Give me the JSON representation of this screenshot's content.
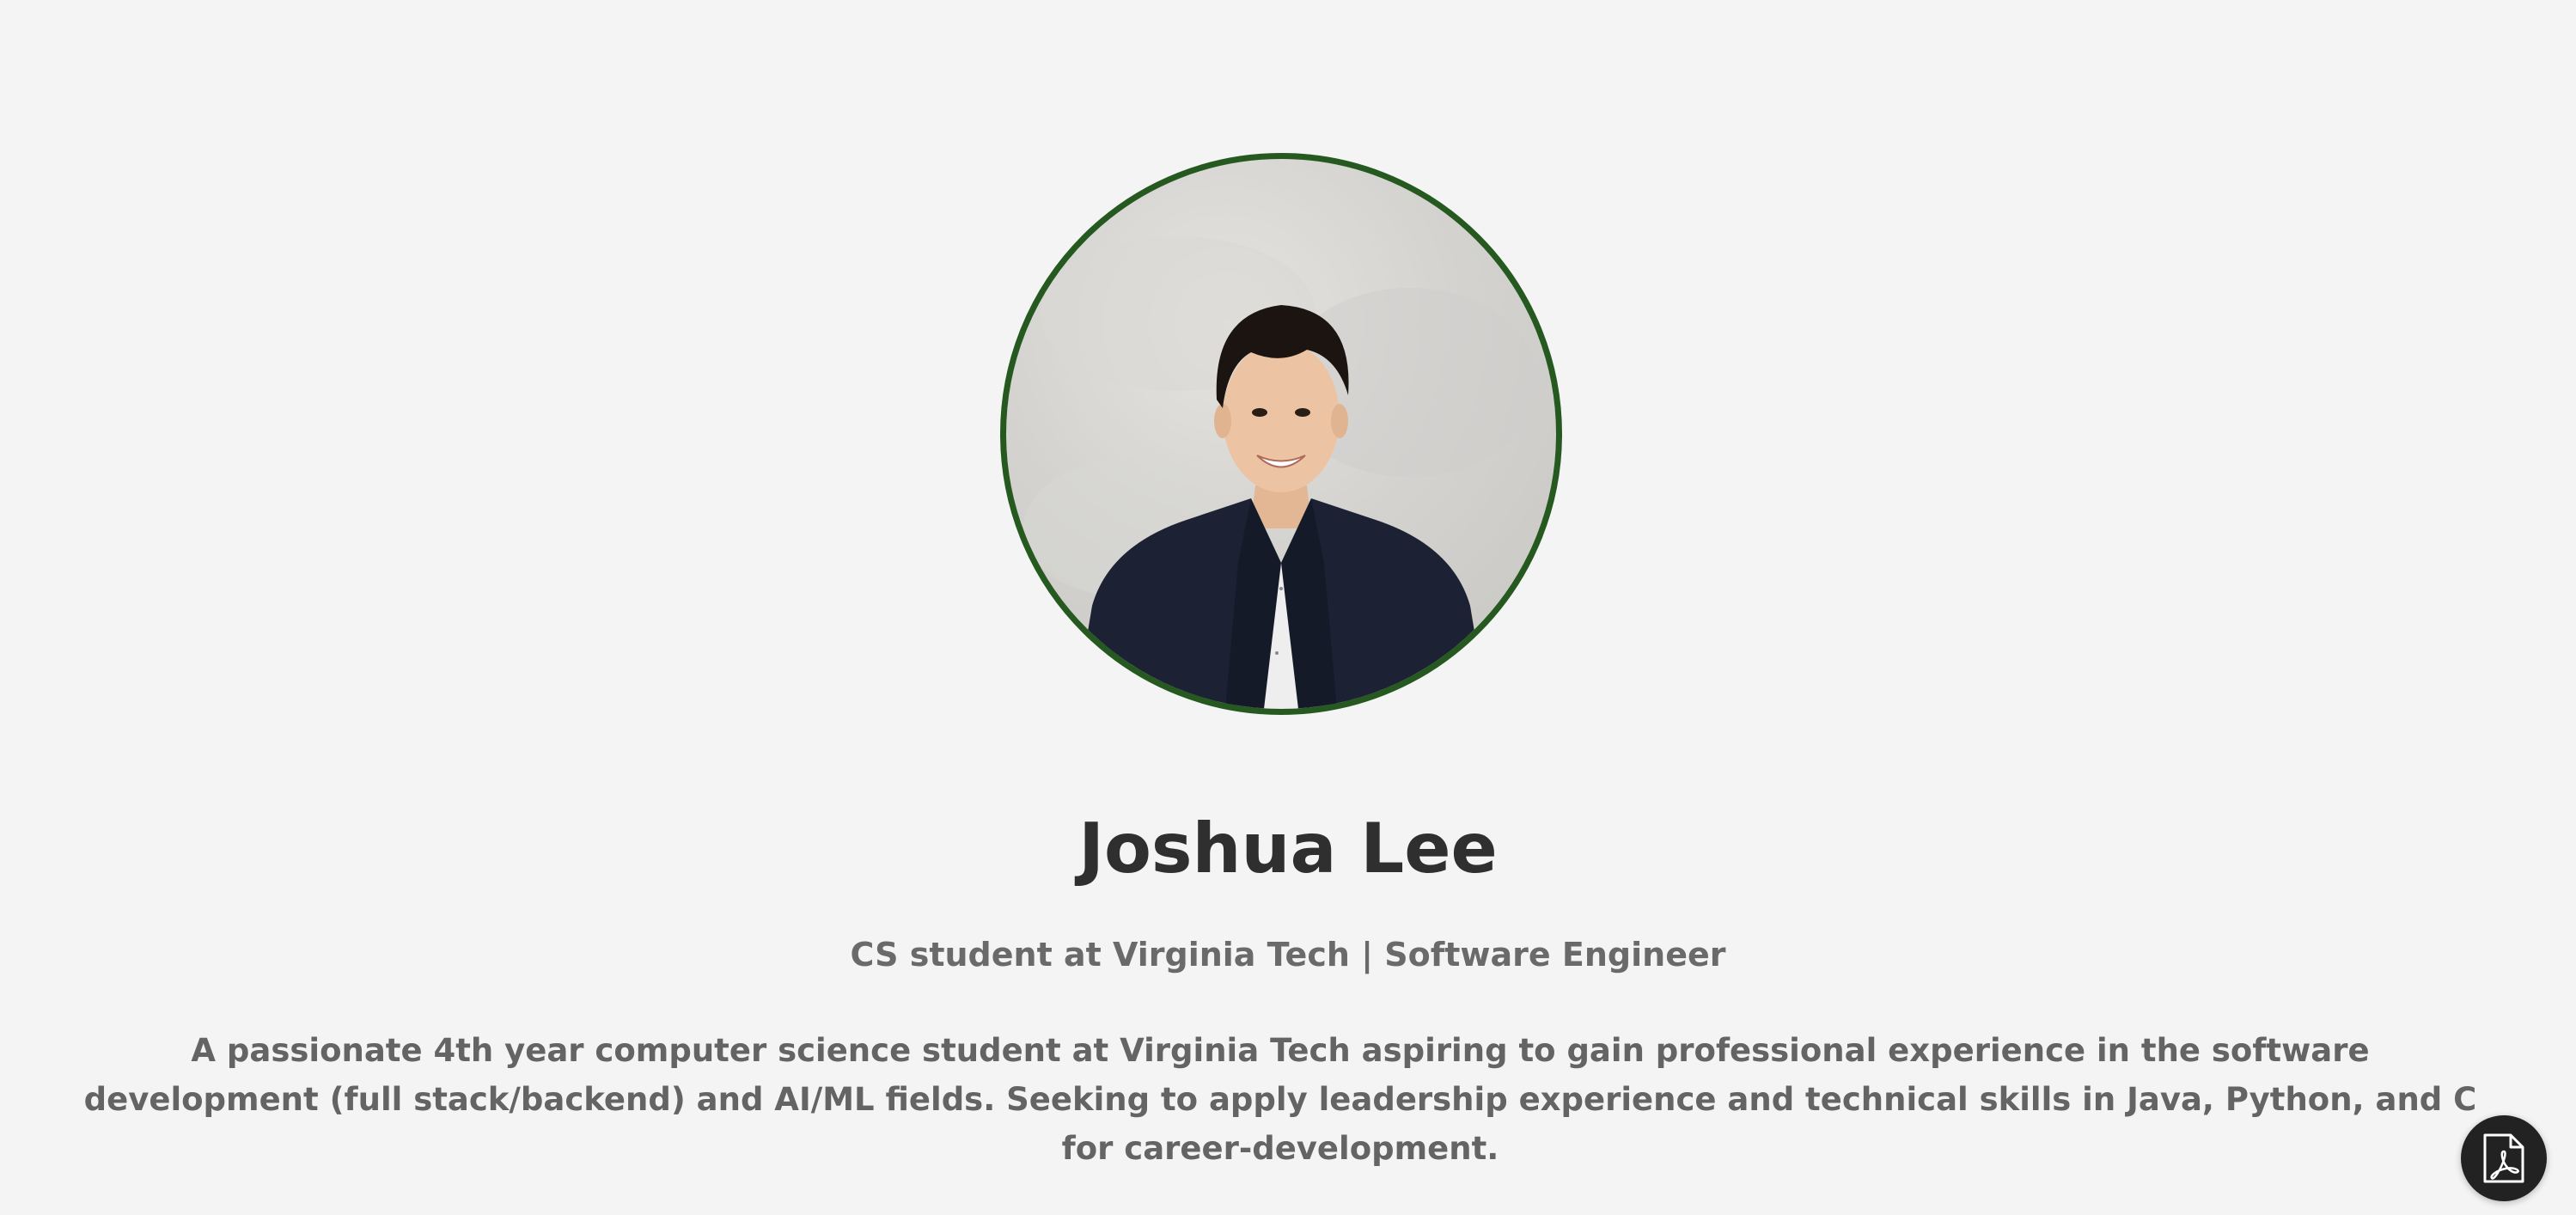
{
  "profile": {
    "name": "Joshua Lee",
    "tagline": "CS student at Virginia Tech | Software Engineer",
    "bio": "A passionate 4th year computer science student at Virginia Tech aspiring to gain professional experience in the software development (full stack/backend) and AI/ML fields. Seeking to apply leadership experience and technical skills in Java, Python, and C for career-development."
  },
  "avatar": {
    "border_color": "#25591f",
    "icon": "profile-photo"
  },
  "floating_action": {
    "icon": "pdf-document-icon",
    "background": "#222222"
  },
  "theme": {
    "page_background": "#f4f4f4",
    "heading_color": "#2f2f2f",
    "text_color": "#646464"
  }
}
